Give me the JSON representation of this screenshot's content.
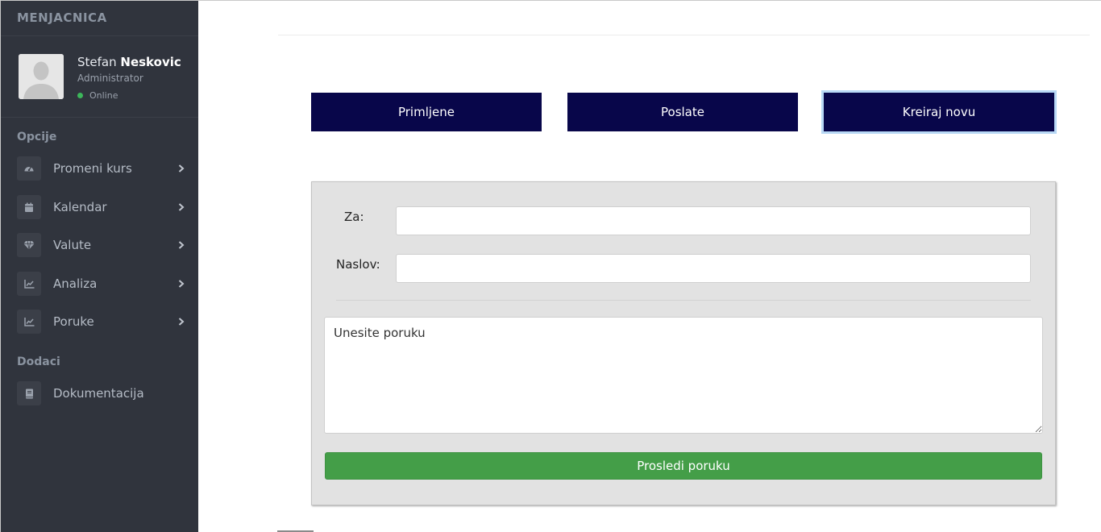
{
  "sidebar": {
    "brand": "MENJACNICA",
    "user": {
      "first_name": "Stefan",
      "last_name": "Neskovic",
      "role": "Administrator",
      "status": "Online"
    },
    "section_options": "Opcije",
    "menu": [
      {
        "label": "Promeni kurs",
        "icon": "dashboard-icon"
      },
      {
        "label": "Kalendar",
        "icon": "calendar-icon"
      },
      {
        "label": "Valute",
        "icon": "diamond-icon"
      },
      {
        "label": "Analiza",
        "icon": "chart-icon"
      },
      {
        "label": "Poruke",
        "icon": "chart-icon"
      }
    ],
    "section_extras": "Dodaci",
    "extras": [
      {
        "label": "Dokumentacija",
        "icon": "book-icon"
      }
    ]
  },
  "tabs": [
    {
      "label": "Primljene"
    },
    {
      "label": "Poslate"
    },
    {
      "label": "Kreiraj novu",
      "active": true
    }
  ],
  "form": {
    "to_label": "Za:",
    "to_value": "",
    "subject_label": "Naslov:",
    "subject_value": "",
    "message_placeholder": "Unesite poruku",
    "send_label": "Prosledi poruku"
  },
  "colors": {
    "sidebar_bg": "#30343d",
    "tab_bg": "#08064a",
    "send_bg": "#449e48",
    "panel_bg": "#e2e2e2",
    "status_online": "#3cb65a"
  }
}
